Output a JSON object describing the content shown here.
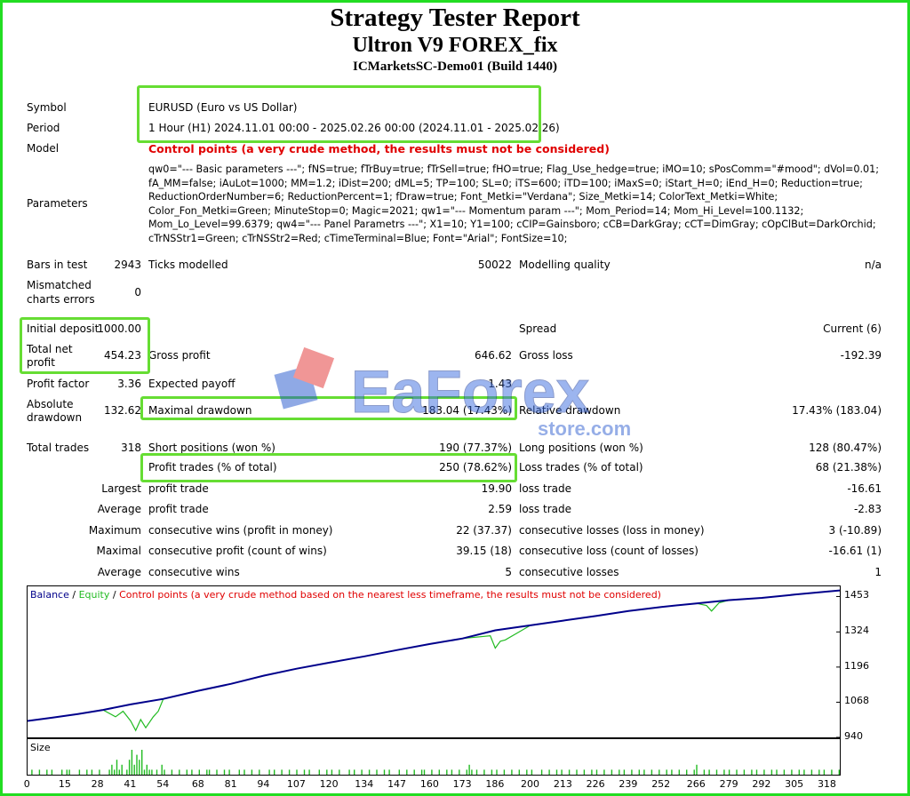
{
  "header": {
    "title": "Strategy Tester Report",
    "subtitle": "Ultron V9 FOREX_fix",
    "server": "ICMarketsSC-Demo01 (Build 1440)"
  },
  "info": {
    "symbol_label": "Symbol",
    "symbol_value": "EURUSD (Euro vs US Dollar)",
    "period_label": "Period",
    "period_value": "1 Hour (H1) 2024.11.01 00:00 - 2025.02.26 00:00 (2024.11.01 - 2025.02.26)",
    "model_label": "Model",
    "model_value": "Control points (a very crude method, the results must not be considered)",
    "parameters_label": "Parameters",
    "parameters_value": "qw0=\"--- Basic parameters ---\"; fNS=true; fTrBuy=true; fTrSell=true; fHO=true; Flag_Use_hedge=true; iMO=10; sPosComm=\"#mood\"; dVol=0.01; fA_MM=false; iAuLot=1000; MM=1.2; iDist=200; dML=5; TP=100; SL=0; iTS=600; iTD=100; iMaxS=0; iStart_H=0; iEnd_H=0; Reduction=true; ReductionOrderNumber=6; ReductionPercent=1; fDraw=true; Font_Metki=\"Verdana\"; Size_Metki=14; ColorText_Metki=White; Color_Fon_Metki=Green; MinuteStop=0; Magic=2021; qw1=\"--- Momentum param ---\"; Mom_Period=14; Mom_Hi_Level=100.1132; Mom_Lo_Level=99.6379; qw4=\"--- Panel Parametrs ---\"; X1=10; Y1=100; cCIP=Gainsboro; cCB=DarkGray; cCT=DimGray; cOpClBut=DarkOrchid; cTrNSStr1=Green; cTrNSStr2=Red; cTimeTerminal=Blue; Font=\"Arial\"; FontSize=10;"
  },
  "stats": {
    "bars_label": "Bars in test",
    "bars_value": "2943",
    "ticks_label": "Ticks modelled",
    "ticks_value": "50022",
    "quality_label": "Modelling quality",
    "quality_value": "n/a",
    "mismatch_label1": "Mismatched",
    "mismatch_label2": "charts errors",
    "mismatch_value": "0",
    "deposit_label": "Initial deposit",
    "deposit_value": "1000.00",
    "spread_label": "Spread",
    "spread_value": "Current (6)",
    "netprofit_label1": "Total net",
    "netprofit_label2": "profit",
    "netprofit_value": "454.23",
    "grossprofit_label": "Gross profit",
    "grossprofit_value": "646.62",
    "grossloss_label": "Gross loss",
    "grossloss_value": "-192.39",
    "pf_label": "Profit factor",
    "pf_value": "3.36",
    "ep_label": "Expected payoff",
    "ep_value": "1.43",
    "absdd_label1": "Absolute",
    "absdd_label2": "drawdown",
    "absdd_value": "132.62",
    "maxdd_label": "Maximal drawdown",
    "maxdd_value": "183.04 (17.43%)",
    "reldd_label": "Relative drawdown",
    "reldd_value": "17.43% (183.04)",
    "trades_label": "Total trades",
    "trades_value": "318",
    "short_label": "Short positions (won %)",
    "short_value": "190 (77.37%)",
    "long_label": "Long positions (won %)",
    "long_value": "128 (80.47%)",
    "profit_trades_label": "Profit trades (% of total)",
    "profit_trades_value": "250 (78.62%)",
    "loss_trades_label": "Loss trades (% of total)",
    "loss_trades_value": "68 (21.38%)",
    "largest_label": "Largest",
    "largest_pt_label": "profit trade",
    "largest_pt_value": "19.90",
    "largest_lt_label": "loss trade",
    "largest_lt_value": "-16.61",
    "average_label": "Average",
    "average_pt_label": "profit trade",
    "average_pt_value": "2.59",
    "average_lt_label": "loss trade",
    "average_lt_value": "-2.83",
    "maximum_label": "Maximum",
    "max_cw_label": "consecutive wins (profit in money)",
    "max_cw_value": "22 (37.37)",
    "max_cl_label": "consecutive losses (loss in money)",
    "max_cl_value": "3 (-10.89)",
    "maximal_label": "Maximal",
    "mxl_cp_label": "consecutive profit (count of wins)",
    "mxl_cp_value": "39.15 (18)",
    "mxl_cl_label": "consecutive loss (count of losses)",
    "mxl_cl_value": "-16.61 (1)",
    "average2_label": "Average",
    "avg_cw_label": "consecutive wins",
    "avg_cw_value": "5",
    "avg_cl_label": "consecutive losses",
    "avg_cl_value": "1"
  },
  "watermark": {
    "text1": "EaForex",
    "text2": "store.com"
  },
  "chart_legend": {
    "balance": "Balance",
    "sep1": " / ",
    "equity": "Equity",
    "sep2": " / ",
    "control": "Control points (a very crude method based on the nearest less timeframe, the results must not be considered)"
  },
  "size_label": "Size",
  "colors": {
    "balance": "#00008b",
    "equity": "#22bb22",
    "size_bars": "#22bb22",
    "highlight": "#66dd33",
    "frame": "#22dd22"
  },
  "chart_data": {
    "type": "line",
    "y_ticks": [
      "1453",
      "1324",
      "1196",
      "1068",
      "940"
    ],
    "x_ticks": [
      "0",
      "15",
      "28",
      "41",
      "54",
      "68",
      "81",
      "94",
      "107",
      "120",
      "134",
      "147",
      "160",
      "173",
      "186",
      "200",
      "213",
      "226",
      "239",
      "252",
      "266",
      "279",
      "292",
      "305",
      "318"
    ],
    "ylim": [
      940,
      1490
    ],
    "xlim": [
      0,
      323
    ],
    "series": [
      {
        "name": "Balance",
        "x": [
          0,
          10,
          20,
          30,
          41,
          54,
          68,
          81,
          94,
          107,
          120,
          134,
          147,
          160,
          173,
          186,
          200,
          213,
          226,
          239,
          252,
          266,
          279,
          292,
          305,
          318,
          323
        ],
        "values": [
          1000,
          1012,
          1025,
          1040,
          1060,
          1080,
          1110,
          1135,
          1165,
          1190,
          1212,
          1235,
          1258,
          1280,
          1300,
          1330,
          1348,
          1365,
          1382,
          1400,
          1415,
          1428,
          1440,
          1448,
          1460,
          1471,
          1475
        ]
      },
      {
        "name": "Equity",
        "x": [
          0,
          10,
          20,
          30,
          35,
          38,
          41,
          43,
          45,
          47,
          50,
          52,
          54,
          68,
          81,
          94,
          107,
          120,
          134,
          147,
          160,
          173,
          184,
          186,
          188,
          190,
          200,
          213,
          226,
          239,
          252,
          266,
          270,
          272,
          275,
          279,
          292,
          305,
          318,
          323
        ],
        "values": [
          1000,
          1012,
          1025,
          1040,
          1015,
          1035,
          1000,
          965,
          1005,
          975,
          1015,
          1035,
          1080,
          1110,
          1135,
          1165,
          1190,
          1212,
          1235,
          1258,
          1280,
          1300,
          1310,
          1265,
          1290,
          1295,
          1348,
          1365,
          1382,
          1400,
          1415,
          1428,
          1420,
          1400,
          1430,
          1440,
          1448,
          1460,
          1471,
          1475
        ]
      }
    ],
    "size_series": [
      0,
      1,
      0,
      0,
      1,
      0,
      0,
      1,
      0,
      1,
      0,
      0,
      0,
      1,
      0,
      1,
      1,
      0,
      0,
      0,
      1,
      0,
      0,
      1,
      0,
      1,
      0,
      0,
      1,
      0,
      0,
      0,
      1,
      2,
      1,
      3,
      1,
      2,
      0,
      1,
      3,
      5,
      2,
      4,
      3,
      5,
      1,
      2,
      1,
      1,
      0,
      1,
      0,
      2,
      1,
      0,
      0,
      1,
      0,
      0,
      1,
      0,
      0,
      1,
      0,
      1,
      0,
      0,
      1,
      0,
      0,
      1,
      1,
      0,
      0,
      1,
      0,
      0,
      1,
      0,
      1,
      0,
      0,
      0,
      1,
      0,
      1,
      0,
      0,
      1,
      0,
      0,
      1,
      0,
      0,
      0,
      1,
      0,
      1,
      0,
      0,
      1,
      0,
      0,
      1,
      0,
      0,
      1,
      0,
      0,
      1,
      0,
      1,
      0,
      0,
      0,
      1,
      0,
      0,
      1,
      0,
      1,
      0,
      0,
      1,
      0,
      0,
      0,
      1,
      0,
      1,
      0,
      0,
      1,
      0,
      0,
      1,
      0,
      0,
      1,
      0,
      0,
      1,
      0,
      1,
      0,
      0,
      0,
      1,
      0,
      0,
      1,
      0,
      0,
      1,
      0,
      0,
      1,
      1,
      0,
      0,
      1,
      0,
      0,
      1,
      0,
      0,
      1,
      0,
      1,
      0,
      0,
      1,
      0,
      0,
      1,
      2,
      1,
      0,
      1,
      0,
      0,
      1,
      0,
      0,
      1,
      0,
      1,
      0,
      0,
      1,
      0,
      0,
      1,
      0,
      0,
      1,
      0,
      0,
      1,
      0,
      1,
      0,
      0,
      0,
      1,
      0,
      0,
      1,
      0,
      0,
      1,
      0,
      1,
      0,
      0,
      1,
      0,
      0,
      1,
      0,
      0,
      1,
      0,
      0,
      1,
      0,
      1,
      0,
      0,
      1,
      0,
      0,
      1,
      0,
      0,
      1,
      0,
      1,
      0,
      0,
      1,
      0,
      0,
      1,
      0,
      1,
      0,
      0,
      1,
      0,
      0,
      1,
      0,
      0,
      1,
      0,
      1,
      0,
      0,
      1,
      0,
      0,
      1,
      0,
      0,
      1,
      2,
      0,
      0,
      1,
      0,
      1,
      0,
      0,
      1,
      0,
      0,
      1,
      0,
      1,
      0,
      0,
      1,
      0,
      0,
      1,
      0,
      0,
      1,
      0,
      1,
      0,
      0,
      1,
      0,
      0,
      1,
      0,
      1,
      0,
      0,
      1,
      0,
      0,
      1,
      0,
      0,
      1,
      0,
      1,
      0,
      0,
      1,
      0,
      0,
      1,
      0,
      1,
      0,
      0,
      1,
      0,
      0,
      1
    ]
  }
}
